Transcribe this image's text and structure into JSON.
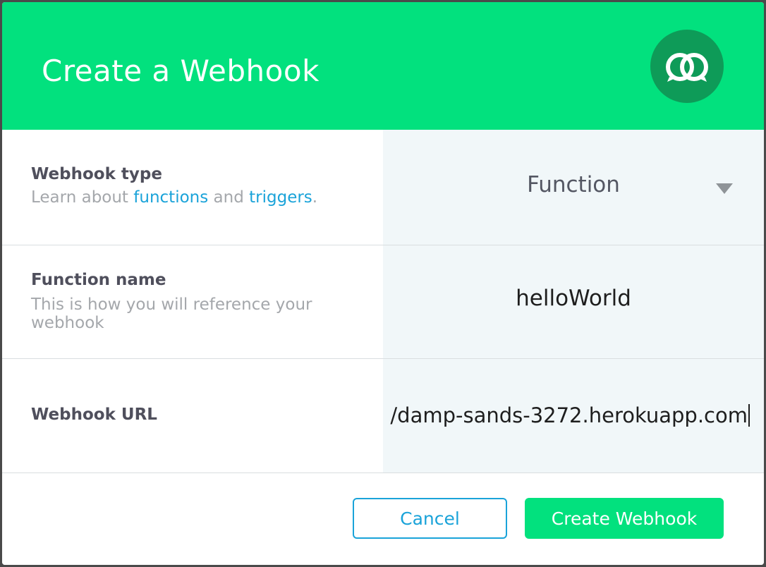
{
  "dialog": {
    "title": "Create a Webhook",
    "logo_icon": "webhook-logo-icon"
  },
  "webhook_type": {
    "label": "Webhook type",
    "desc_prefix": "Learn about ",
    "link_functions": "functions",
    "desc_middle": " and ",
    "link_triggers": "triggers",
    "desc_suffix": ".",
    "selected": "Function",
    "caret_icon": "caret-down-icon"
  },
  "function_name": {
    "label": "Function name",
    "desc": "This is how you will reference your webhook",
    "value": "helloWorld"
  },
  "webhook_url": {
    "label": "Webhook URL",
    "value": "/damp-sands-3272.herokuapp.com"
  },
  "footer": {
    "cancel_label": "Cancel",
    "create_label": "Create Webhook"
  },
  "colors": {
    "brand_green": "#02e17e",
    "link_blue": "#1aa3d9",
    "logo_dark_green": "#0e9b58"
  }
}
